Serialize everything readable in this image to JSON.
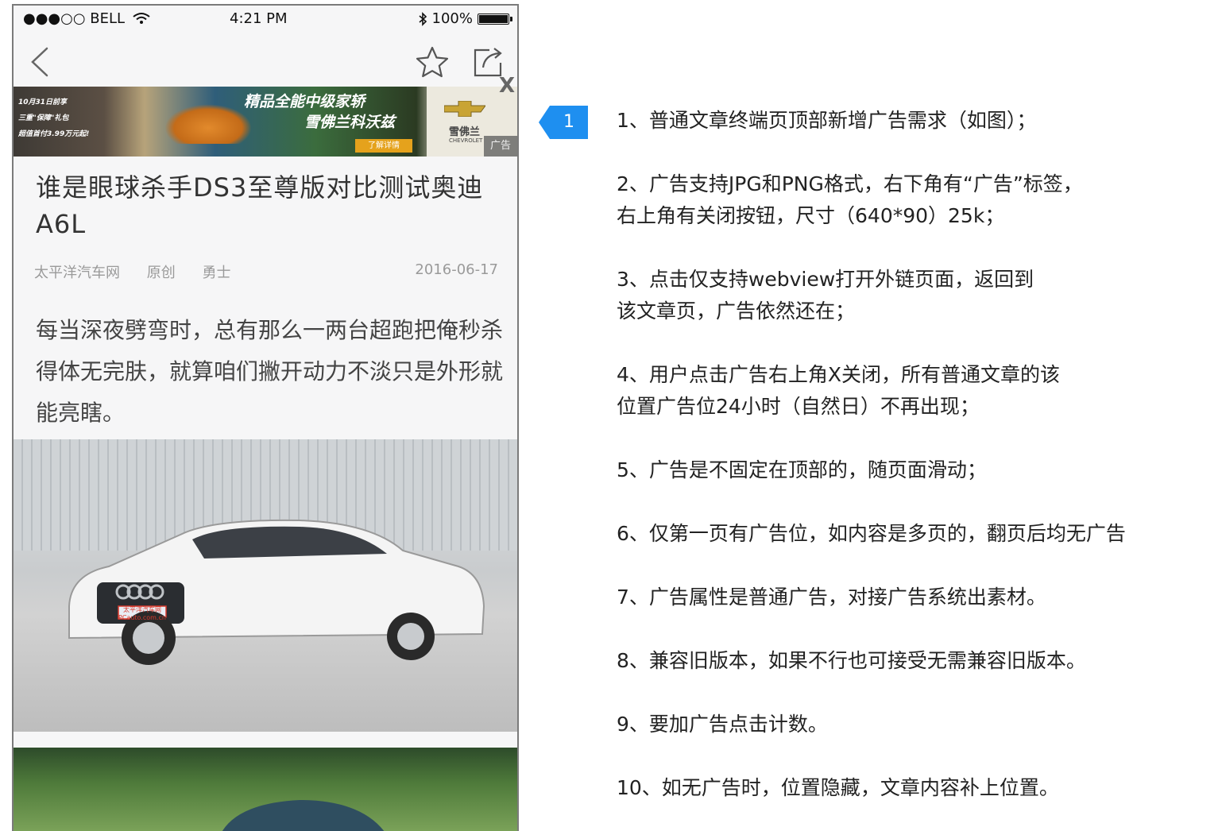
{
  "status_bar": {
    "carrier": "●●●○○ BELL",
    "time": "4:21 PM",
    "battery": "100%"
  },
  "ad": {
    "promo_lines": [
      "10月31日前享",
      "三重\"保障\"礼包",
      "超值首付3.99万元起!"
    ],
    "slogan_line1": "精品全能中级家轿",
    "slogan_line2": "雪佛兰科沃兹",
    "cta": "了解详情",
    "brand_name": "雪佛兰",
    "brand_sub": "CHEVROLET",
    "label": "广告",
    "close": "X"
  },
  "article": {
    "title": "谁是眼球杀手DS3至尊版对比测试奥迪A6L",
    "source": "太平洋汽车网",
    "type": "原创",
    "author": "勇士",
    "date": "2016-06-17",
    "body": "每当深夜劈弯时，总有那么一两台超跑把俺秒杀得体无完肤，就算咱们撇开动力不淡只是外形就能亮瞎。",
    "plate_line1": "太平洋汽车网",
    "plate_line2": "PCauto.com.cn"
  },
  "annotation": {
    "marker": "1",
    "accent": "#1e8ff0",
    "notes": [
      "1、普通文章终端页顶部新增广告需求（如图）；",
      "2、广告支持JPG和PNG格式，右下角有“广告”标签，\n右上角有关闭按钮，尺寸（640*90）25k；",
      "3、点击仅支持webview打开外链页面，返回到\n该文章页，广告依然还在；",
      "4、用户点击广告右上角X关闭，所有普通文章的该\n位置广告位24小时（自然日）不再出现；",
      "5、广告是不固定在顶部的，随页面滑动；",
      "6、仅第一页有广告位，如内容是多页的，翻页后均无广告",
      "7、广告属性是普通广告，对接广告系统出素材。",
      "8、兼容旧版本，如果不行也可接受无需兼容旧版本。",
      "9、要加广告点击计数。",
      "10、如无广告时，位置隐藏，文章内容补上位置。"
    ]
  }
}
